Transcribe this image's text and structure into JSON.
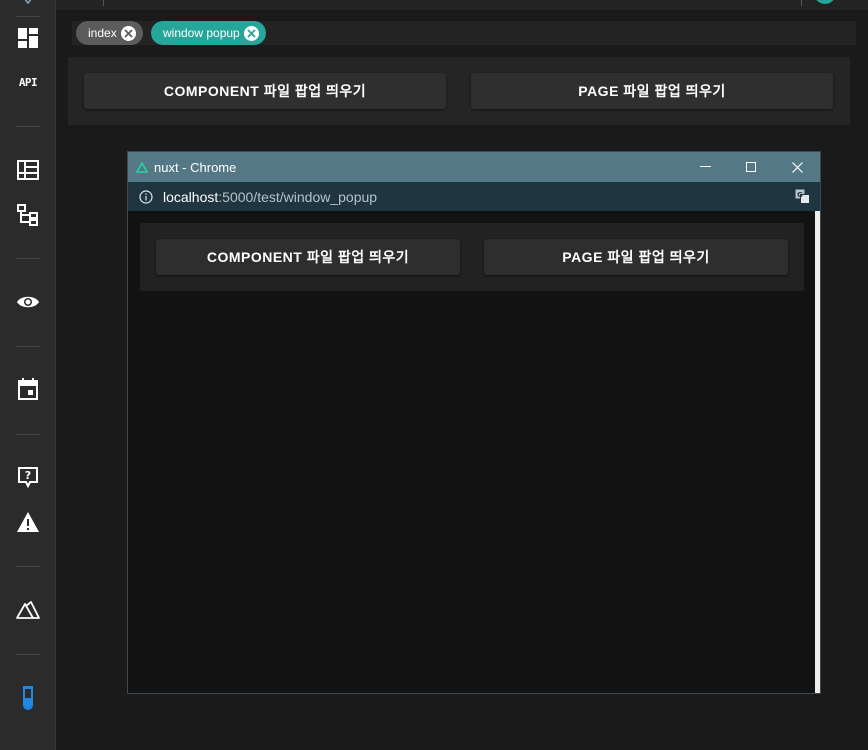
{
  "sidebar": {
    "api_label": "API",
    "icons": [
      "dashboard-icon",
      "api-icon",
      "table-icon",
      "sitemap-icon",
      "eye-icon",
      "calendar-icon",
      "help-bubble-icon",
      "warning-icon",
      "nuxt-logo-icon",
      "test-tube-icon"
    ]
  },
  "tabs": [
    {
      "label": "index",
      "active": false,
      "color": "#5c5c5c"
    },
    {
      "label": "window popup",
      "active": true,
      "color": "#26a69a"
    }
  ],
  "main": {
    "component_button": "COMPONENT 파일 팝업 띄우기",
    "page_button": "PAGE 파일 팝업 띄우기"
  },
  "popup": {
    "title": "nuxt - Chrome",
    "url_host": "localhost",
    "url_path": ":5000/test/window_popup",
    "component_button": "COMPONENT 파일 팝업 띄우기",
    "page_button": "PAGE 파일 팝업 띄우기"
  },
  "colors": {
    "accent": "#26a69a",
    "titlebar": "#547886",
    "addressbar": "#1f3540",
    "test_tube": "#1e88e5"
  }
}
